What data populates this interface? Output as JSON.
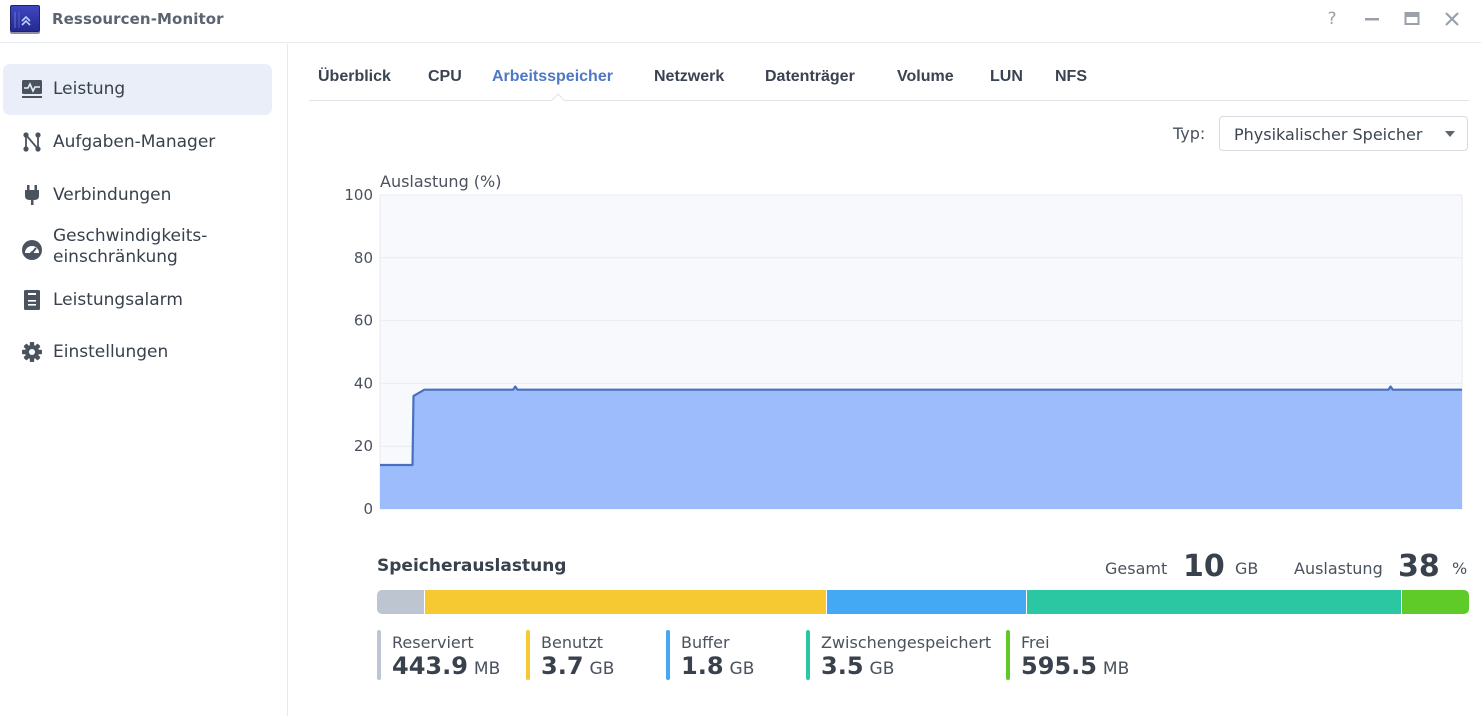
{
  "window": {
    "title": "Ressourcen-Monitor",
    "controls": {
      "help": "?",
      "minimize": "—",
      "maximize": "▭",
      "close": "✕"
    }
  },
  "sidebar": {
    "items": [
      {
        "label": "Leistung",
        "icon": "performance-monitor-icon",
        "active": true
      },
      {
        "label": "Aufgaben-Manager",
        "icon": "task-manager-icon",
        "active": false
      },
      {
        "label": "Verbindungen",
        "icon": "plug-icon",
        "active": false
      },
      {
        "label": "Geschwindigkeits-",
        "label2": "einschränkung",
        "icon": "speedometer-icon",
        "active": false
      },
      {
        "label": "Leistungsalarm",
        "icon": "alarm-list-icon",
        "active": false
      },
      {
        "label": "Einstellungen",
        "icon": "gear-icon",
        "active": false
      }
    ]
  },
  "tabs": [
    {
      "label": "Überblick",
      "active": false
    },
    {
      "label": "CPU",
      "active": false
    },
    {
      "label": "Arbeitsspeicher",
      "active": true
    },
    {
      "label": "Netzwerk",
      "active": false
    },
    {
      "label": "Datenträger",
      "active": false
    },
    {
      "label": "Volume",
      "active": false
    },
    {
      "label": "LUN",
      "active": false
    },
    {
      "label": "NFS",
      "active": false
    }
  ],
  "type_selector": {
    "label": "Typ:",
    "value": "Physikalischer Speicher"
  },
  "chart_data": {
    "type": "area",
    "title": "Auslastung (%)",
    "ylabel": "Auslastung (%)",
    "xlabel": "",
    "ylim": [
      0,
      100
    ],
    "yticks": [
      0,
      20,
      40,
      60,
      80,
      100
    ],
    "grid": true,
    "legend": "none",
    "colors": {
      "line": "#4a6fc0",
      "fill": "#9cbcfb",
      "background": "#f8f9fc",
      "grid": "#e8ebf0"
    },
    "x": [
      0,
      2,
      3,
      3.1,
      3.6,
      4.1,
      12.3,
      12.5,
      12.7,
      93.2,
      93.4,
      93.6,
      100
    ],
    "series": [
      {
        "name": "Auslastung",
        "values": [
          14,
          14,
          14,
          36,
          37,
          38,
          38,
          39,
          38,
          38,
          39,
          38,
          38
        ]
      }
    ]
  },
  "usage": {
    "title": "Speicherauslastung",
    "total_label": "Gesamt",
    "total_value": "10",
    "total_unit": "GB",
    "util_label": "Auslastung",
    "util_value": "38",
    "util_unit": "%",
    "segments": [
      {
        "name": "Reserviert",
        "value": "443.9",
        "unit": "MB",
        "fraction": 0.044,
        "color": "#bdc5d0"
      },
      {
        "name": "Benutzt",
        "value": "3.7",
        "unit": "GB",
        "fraction": 0.368,
        "color": "#f6c831"
      },
      {
        "name": "Buffer",
        "value": "1.8",
        "unit": "GB",
        "fraction": 0.183,
        "color": "#43a9f4"
      },
      {
        "name": "Zwischengespeichert",
        "value": "3.5",
        "unit": "GB",
        "fraction": 0.344,
        "color": "#2bc7a2"
      },
      {
        "name": "Frei",
        "value": "595.5",
        "unit": "MB",
        "fraction": 0.061,
        "color": "#5fcb28"
      }
    ]
  }
}
